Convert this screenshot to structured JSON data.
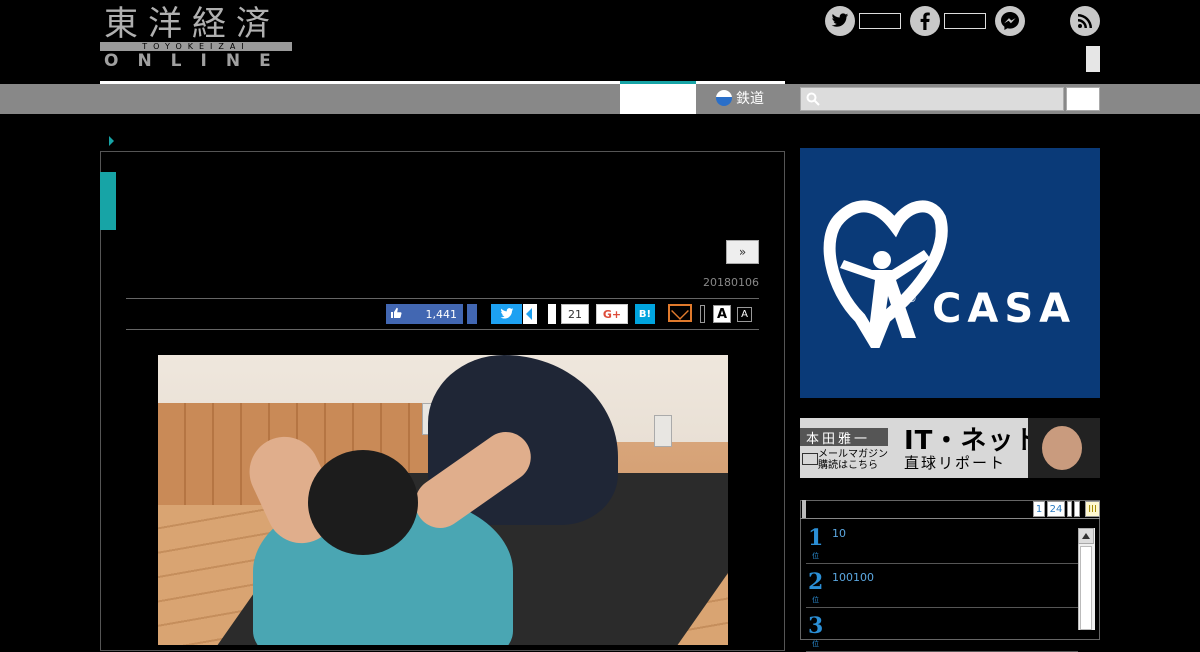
{
  "logo": {
    "kanji": "東洋経済",
    "roman": "TOYOKEIZAI",
    "online": "ONLINE"
  },
  "social": {
    "twitter_icon": "twitter-icon",
    "facebook_icon": "facebook-icon",
    "messenger_icon": "messenger-icon",
    "rss_icon": "rss-icon"
  },
  "nav": {
    "rail_label": "鉄道"
  },
  "article": {
    "next_label": "»",
    "date": "20180106",
    "share": {
      "like_count": "1,441",
      "hatena_count": "21",
      "gplus_label": "G+",
      "hatena_label": "B!",
      "font_large": "A",
      "font_small": "A"
    }
  },
  "sidebar": {
    "casa_brand": "CASA",
    "casa_reg": "®",
    "banner": {
      "name": "本田雅一",
      "title": "IT・ネット",
      "subtitle": "直球リポート",
      "mail_line1": "メールマガジン",
      "mail_line2": "購読はこちら"
    },
    "ranking": {
      "tab1": "1",
      "tab2": "24",
      "tab_last": "III",
      "items": [
        {
          "rank": "1",
          "suffix": "位",
          "text": "10"
        },
        {
          "rank": "2",
          "suffix": "位",
          "text": "100100"
        },
        {
          "rank": "3",
          "suffix": "位",
          "text": ""
        }
      ]
    }
  }
}
